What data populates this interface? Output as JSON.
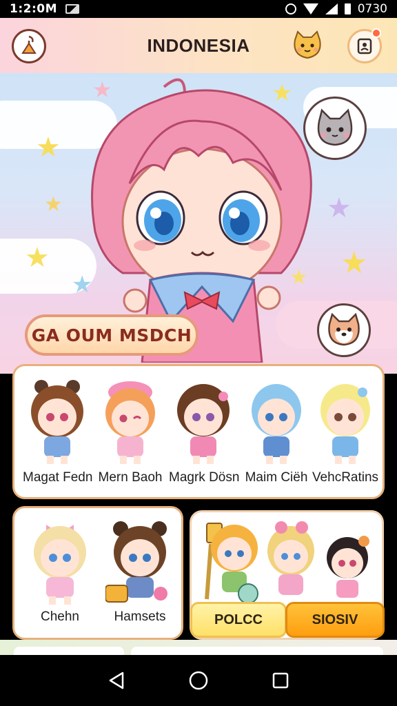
{
  "status_bar": {
    "time": "1:2:0M",
    "battery_text": "0730"
  },
  "header": {
    "title": "INDONESIA"
  },
  "hero": {
    "banner_text": "GA OUM MSDCH"
  },
  "top_row": [
    {
      "name": "Magat Fedn",
      "hair": "#8a4e2a",
      "outfit": "#7da7e0"
    },
    {
      "name": "Mern Baoh",
      "hair": "#f5a05a",
      "outfit": "#f6b3cf"
    },
    {
      "name": "Magrk Dösn",
      "hair": "#6b3d22",
      "outfit": "#f08ab5"
    },
    {
      "name": "Maim Ciëh",
      "hair": "#8ec7ee",
      "outfit": "#5f8fd0"
    },
    {
      "name": "VehcRatins",
      "hair": "#f6e98a",
      "outfit": "#7bb6e8"
    }
  ],
  "bottom_left": [
    {
      "name": "Chehn",
      "hair": "#f4dfa6",
      "outfit": "#f6b8d6"
    },
    {
      "name": "Hamsets",
      "hair": "#6d4327",
      "outfit": "#6d8cc7"
    }
  ],
  "bottom_right": {
    "characters": [
      {
        "hair": "#f6b23f",
        "outfit": "#8bc46c"
      },
      {
        "hair": "#f1d27d",
        "outfit": "#f3a6c8"
      },
      {
        "hair": "#2c2224",
        "outfit": "#f59cc0"
      }
    ],
    "button_left": "POLCC",
    "button_right": "SIOSIV"
  },
  "icons": {
    "header_left": "kite-icon",
    "header_cat": "cat-face-icon",
    "header_right": "profile-card-icon",
    "nav_back": "back-triangle-icon",
    "nav_home": "home-circle-icon",
    "nav_recent": "recent-square-icon"
  },
  "colors": {
    "accent_orange": "#ff9e10",
    "header_pink": "#fbd4dd",
    "hero_hair": "#f08aa8"
  }
}
